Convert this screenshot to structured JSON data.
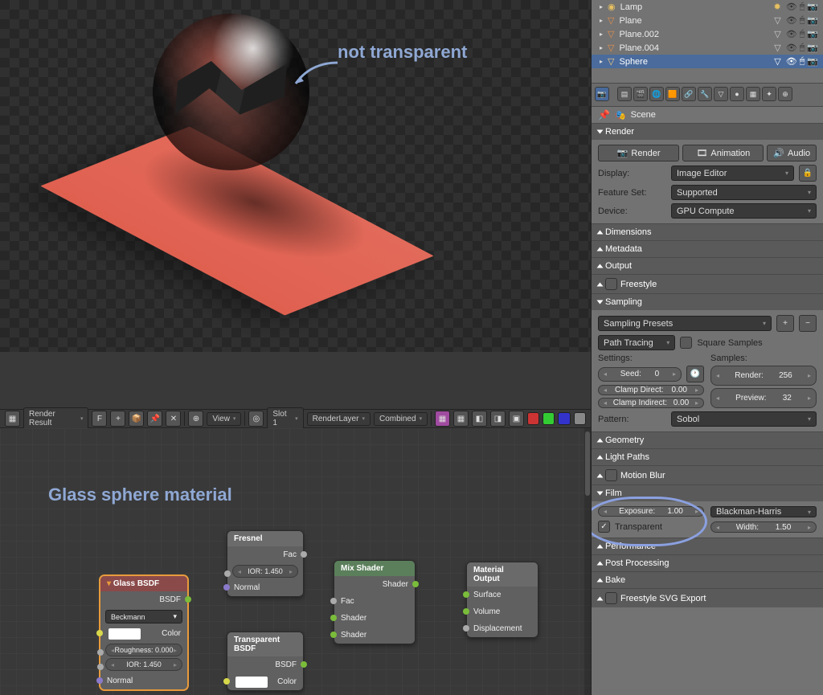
{
  "annot": {
    "label": "not transparent"
  },
  "toolbar": {
    "renderResult": "Render Result",
    "f": "F",
    "view": "View",
    "slot": "Slot 1",
    "layer": "RenderLayer",
    "pass": "Combined"
  },
  "nodeEditor": {
    "title": "Glass sphere material",
    "nodes": {
      "glass": {
        "title": "Glass BSDF",
        "out": "BSDF",
        "dist": "Beckmann",
        "color": "Color",
        "rough_lbl": "Roughness:",
        "rough": "0.000",
        "ior_lbl": "IOR:",
        "ior": "1.450",
        "normal": "Normal"
      },
      "transp": {
        "title": "Transparent BSDF",
        "out": "BSDF",
        "color": "Color"
      },
      "fresnel": {
        "title": "Fresnel",
        "out": "Fac",
        "ior_lbl": "IOR:",
        "ior": "1.450",
        "normal": "Normal"
      },
      "mix": {
        "title": "Mix Shader",
        "out": "Shader",
        "fac": "Fac",
        "sh1": "Shader",
        "sh2": "Shader"
      },
      "out": {
        "title": "Material Output",
        "surface": "Surface",
        "volume": "Volume",
        "disp": "Displacement"
      }
    }
  },
  "outliner": {
    "items": [
      {
        "name": "Lamp",
        "icon": "lamp",
        "indent": 1,
        "sel": false
      },
      {
        "name": "Plane",
        "icon": "mesh",
        "indent": 1,
        "sel": false
      },
      {
        "name": "Plane.002",
        "icon": "mesh",
        "indent": 1,
        "sel": false
      },
      {
        "name": "Plane.004",
        "icon": "mesh",
        "indent": 1,
        "sel": false
      },
      {
        "name": "Sphere",
        "icon": "mesh",
        "indent": 1,
        "sel": true
      }
    ]
  },
  "props": {
    "scene": "Scene",
    "panels": {
      "render": {
        "title": "Render",
        "render": "Render",
        "anim": "Animation",
        "audio": "Audio",
        "display_lbl": "Display:",
        "display": "Image Editor",
        "feature_lbl": "Feature Set:",
        "feature": "Supported",
        "device_lbl": "Device:",
        "device": "GPU Compute"
      },
      "dimensions": "Dimensions",
      "metadata": "Metadata",
      "output": "Output",
      "freestyle": "Freestyle",
      "sampling": {
        "title": "Sampling",
        "preset": "Sampling Presets",
        "integ": "Path Tracing",
        "square": "Square Samples",
        "settings": "Settings:",
        "samples": "Samples:",
        "seed_lbl": "Seed:",
        "seed": "0",
        "clampd_lbl": "Clamp Direct:",
        "clampd": "0.00",
        "clampi_lbl": "Clamp Indirect:",
        "clampi": "0.00",
        "rend_lbl": "Render:",
        "rend": "256",
        "prev_lbl": "Preview:",
        "prev": "32",
        "pattern_lbl": "Pattern:",
        "pattern": "Sobol"
      },
      "geometry": "Geometry",
      "light": "Light Paths",
      "motion": "Motion Blur",
      "film": {
        "title": "Film",
        "exp_lbl": "Exposure:",
        "exp": "1.00",
        "filter": "Blackman-Harris",
        "transp": "Transparent",
        "width_lbl": "Width:",
        "width": "1.50"
      },
      "perf": "Performance",
      "post": "Post Processing",
      "bake": "Bake",
      "svg": "Freestyle SVG Export"
    }
  }
}
